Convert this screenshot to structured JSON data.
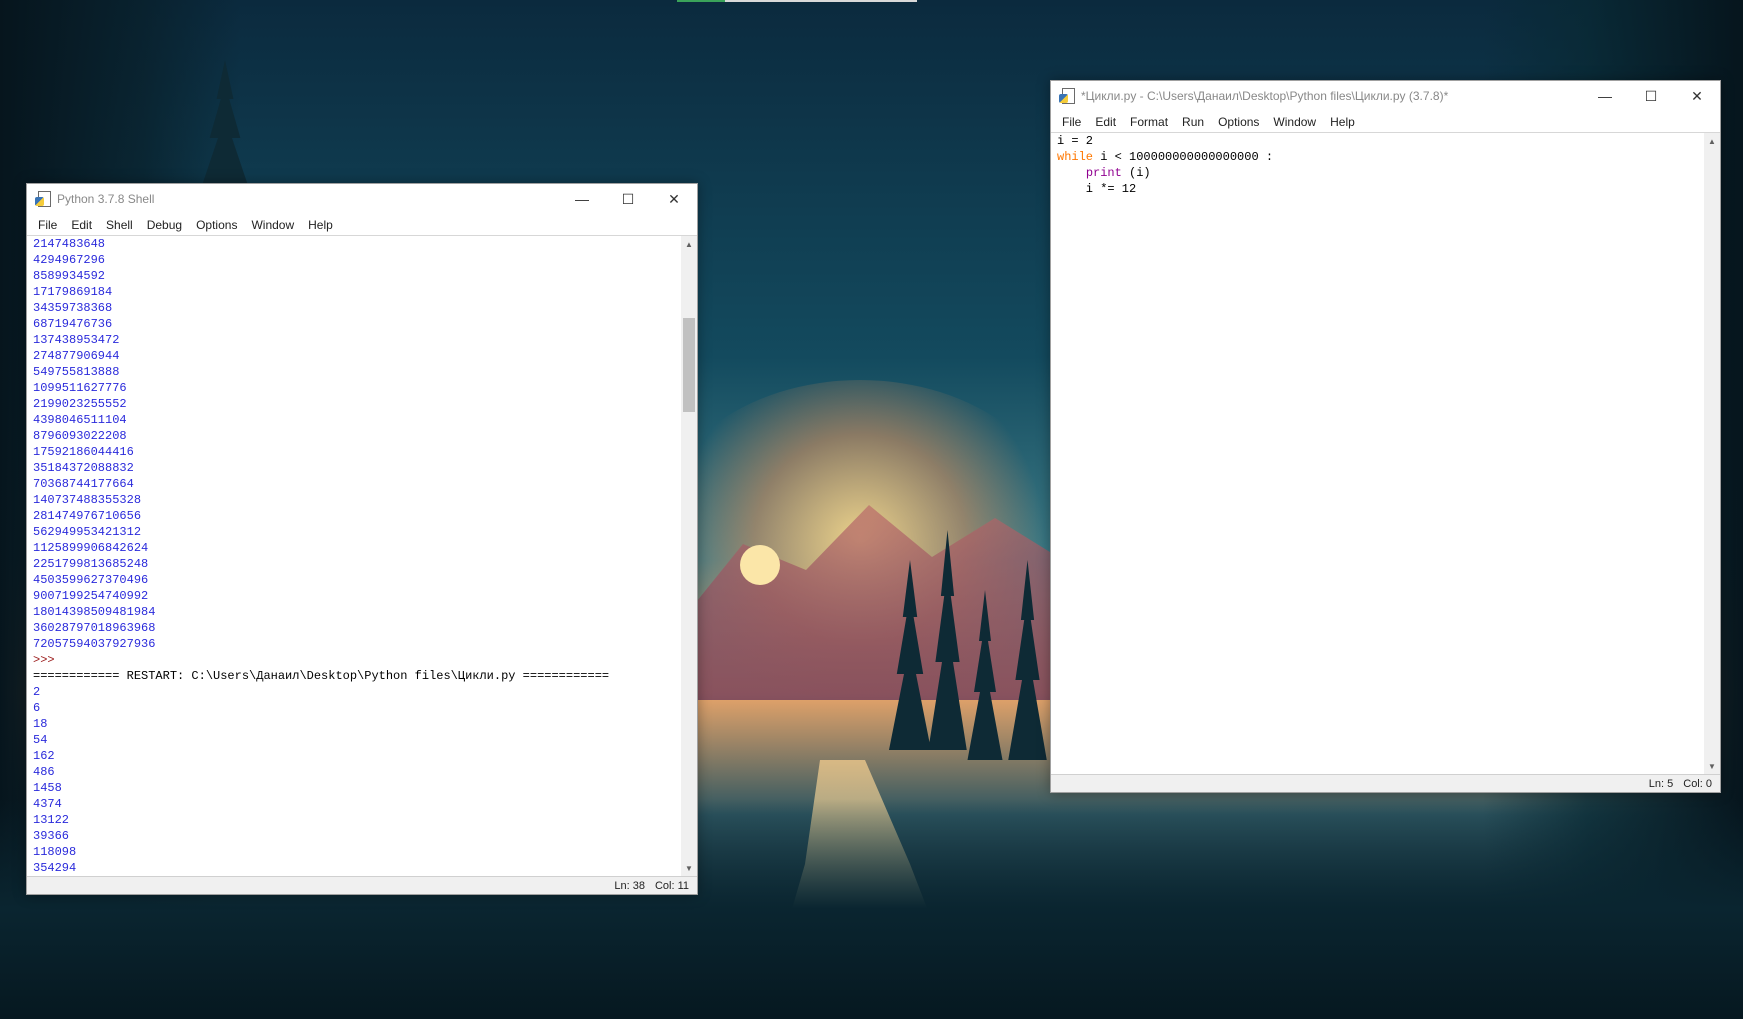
{
  "shell": {
    "title": "Python 3.7.8 Shell",
    "menu": [
      "File",
      "Edit",
      "Shell",
      "Debug",
      "Options",
      "Window",
      "Help"
    ],
    "output_before": [
      "2147483648",
      "4294967296",
      "8589934592",
      "17179869184",
      "34359738368",
      "68719476736",
      "137438953472",
      "274877906944",
      "549755813888",
      "1099511627776",
      "2199023255552",
      "4398046511104",
      "8796093022208",
      "17592186044416",
      "35184372088832",
      "70368744177664",
      "140737488355328",
      "281474976710656",
      "562949953421312",
      "1125899906842624",
      "2251799813685248",
      "4503599627370496",
      "9007199254740992",
      "18014398509481984",
      "36028797018963968",
      "72057594037927936"
    ],
    "prompt": ">>>",
    "restart_line": "============ RESTART: C:\\Users\\Данаил\\Desktop\\Python files\\Цикли.py ============",
    "output_after": [
      "2",
      "6",
      "18",
      "54",
      "162",
      "486",
      "1458",
      "4374",
      "13122",
      "39366",
      "118098",
      "354294"
    ],
    "status_ln": "Ln: 38",
    "status_col": "Col: 11"
  },
  "editor": {
    "title": "*Цикли.py - C:\\Users\\Данаил\\Desktop\\Python files\\Цикли.py (3.7.8)*",
    "menu": [
      "File",
      "Edit",
      "Format",
      "Run",
      "Options",
      "Window",
      "Help"
    ],
    "code": {
      "l1": "i = 2",
      "l2_kw": "while",
      "l2_rest": " i < 100000000000000000 :",
      "l3_indent": "    ",
      "l3_bi": "print",
      "l3_rest": " (i)",
      "l4": "    i *= 12"
    },
    "status_ln": "Ln: 5",
    "status_col": "Col: 0"
  },
  "window_controls": {
    "minimize": "—",
    "maximize": "☐",
    "close": "✕"
  }
}
